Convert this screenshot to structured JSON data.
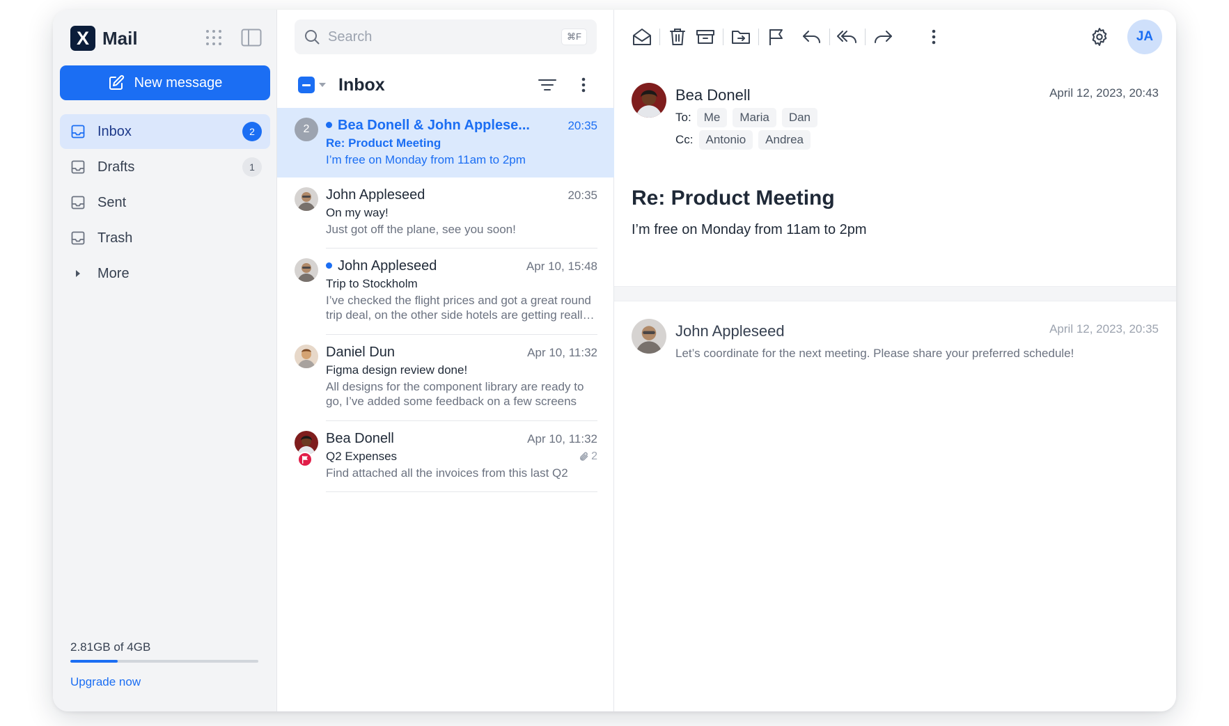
{
  "brand": {
    "logo_letter": "X",
    "name": "Mail",
    "logo_color": "#0b1d3a"
  },
  "theme": {
    "accent": "#1b6ef3",
    "selected_bg": "#dbe9fd",
    "flag_color": "#e11d48"
  },
  "sidebar": {
    "new_message_label": "New message",
    "items": [
      {
        "label": "Inbox",
        "badge": "2",
        "icon": "inbox-icon"
      },
      {
        "label": "Drafts",
        "badge": "1",
        "icon": "inbox-icon"
      },
      {
        "label": "Sent",
        "badge": "",
        "icon": "inbox-icon"
      },
      {
        "label": "Trash",
        "badge": "",
        "icon": "inbox-icon"
      },
      {
        "label": "More",
        "badge": "",
        "icon": "caret-right-icon"
      }
    ],
    "storage": {
      "text": "2.81GB of 4GB",
      "used_fraction": 0.25
    },
    "upgrade_label": "Upgrade now"
  },
  "search": {
    "placeholder": "Search",
    "shortcut": "⌘F"
  },
  "list": {
    "title": "Inbox",
    "messages": [
      {
        "from": "Bea Donell & John Applese...",
        "time": "20:35",
        "subject": "Re: Product Meeting",
        "preview": "I’m free on Monday from 11am to 2pm",
        "count": "2",
        "unread": true,
        "selected": true
      },
      {
        "from": "John Appleseed",
        "time": "20:35",
        "subject": "On my way!",
        "preview": "Just got off the plane, see you soon!",
        "unread": false
      },
      {
        "from": "John Appleseed",
        "time": "Apr 10, 15:48",
        "subject": "Trip to Stockholm",
        "preview": "I’ve checked the flight prices and got a great round trip deal, on the other side hotels are getting really expensive",
        "unread": true
      },
      {
        "from": "Daniel Dun",
        "time": "Apr 10, 11:32",
        "subject": "Figma design review done!",
        "preview": "All designs for the component library are ready to go, I’ve added some feedback on a few screens",
        "unread": false
      },
      {
        "from": "Bea Donell",
        "time": "Apr 10, 11:32",
        "subject": "Q2 Expenses",
        "preview": "Find attached all the invoices from this last Q2",
        "attachments": "2",
        "flagged": true,
        "unread": false
      }
    ]
  },
  "reader": {
    "user_initials": "JA",
    "from": "Bea Donell",
    "date": "April 12, 2023, 20:43",
    "to_label": "To:",
    "to": [
      "Me",
      "Maria",
      "Dan"
    ],
    "cc_label": "Cc:",
    "cc": [
      "Antonio",
      "Andrea"
    ],
    "subject": "Re: Product Meeting",
    "body": "I’m free on Monday from 11am to 2pm",
    "thread": {
      "from": "John Appleseed",
      "date": "April 12, 2023, 20:35",
      "preview": "Let’s coordinate for the next meeting. Please share your preferred schedule!"
    }
  }
}
